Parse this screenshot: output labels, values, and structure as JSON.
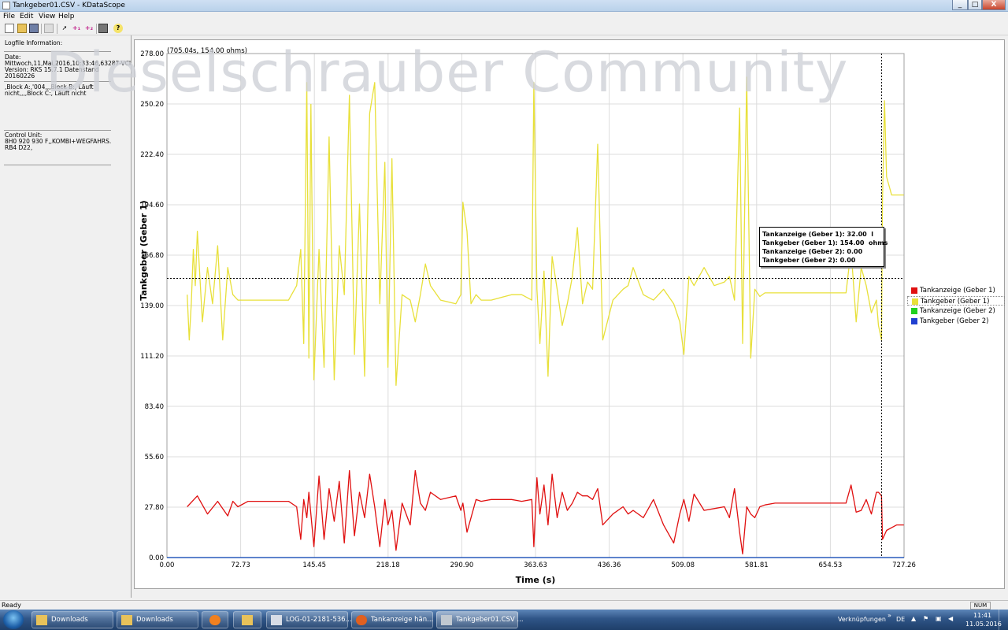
{
  "window": {
    "title": "Tankgeber01.CSV - KDataScope",
    "minimize": "_",
    "maximize": "□",
    "close": "X"
  },
  "menu": [
    "File",
    "Edit",
    "View",
    "Help"
  ],
  "left_panel": {
    "logfile_title": "Logfile Information:",
    "date_label": "Date:",
    "date_value": "Mittwoch,11,Mai,2016,10:33:46,63287-VCI",
    "version_value": "Version: RKS 15.7.1 Datenstand",
    "build_value": "20160226",
    "blocks_line1": ",Block A:,'004,,,Block B:, Läuft",
    "blocks_line2": "nicht,,,,Block C:, Läuft nicht",
    "control_unit_label": "Control Unit:",
    "control_unit_line1": "8H0 920 930 F,,KOMBI+WEGFAHRS.",
    "control_unit_line2": "RB4 D22,"
  },
  "chart_data": {
    "type": "line",
    "cursor_readout": "(705.04s, 154.00 ohms)",
    "ylabel": "Tankgeber (Geber 1)",
    "xlabel": "Time (s)",
    "ylim": [
      0,
      278
    ],
    "xlim": [
      0,
      727.26
    ],
    "y_ticks": [
      "0.00",
      "27.80",
      "55.60",
      "83.40",
      "111.20",
      "139.00",
      "166.80",
      "194.60",
      "222.40",
      "250.20",
      "278.00"
    ],
    "x_ticks": [
      "0.00",
      "72.73",
      "145.45",
      "218.18",
      "290.90",
      "363.63",
      "436.36",
      "509.08",
      "581.81",
      "654.53",
      "727.26"
    ],
    "cursor_x": 705.04,
    "cursor_y": 154.0,
    "grid": true,
    "legend_position": "right",
    "series": [
      {
        "name": "Tankanzeige (Geber 1)",
        "color": "#e01010",
        "x": [
          20,
          30,
          40,
          50,
          60,
          65,
          70,
          80,
          100,
          120,
          128,
          132,
          135,
          138,
          140,
          145,
          150,
          155,
          160,
          165,
          170,
          175,
          180,
          185,
          190,
          195,
          200,
          205,
          210,
          215,
          218,
          222,
          226,
          232,
          240,
          245,
          250,
          255,
          260,
          270,
          285,
          290,
          292,
          296,
          300,
          305,
          310,
          320,
          340,
          350,
          360,
          362,
          365,
          368,
          372,
          376,
          380,
          385,
          390,
          395,
          400,
          405,
          410,
          415,
          420,
          425,
          430,
          440,
          450,
          455,
          460,
          470,
          480,
          490,
          500,
          506,
          510,
          515,
          520,
          530,
          540,
          550,
          555,
          560,
          565,
          568,
          572,
          576,
          580,
          585,
          590,
          600,
          620,
          640,
          660,
          670,
          675,
          680,
          685,
          690,
          695,
          700,
          702,
          705,
          706,
          710,
          720,
          727
        ],
        "values": [
          28,
          34,
          24,
          31,
          23,
          31,
          28,
          31,
          31,
          31,
          28,
          10,
          32,
          22,
          36,
          6,
          45,
          10,
          38,
          20,
          42,
          8,
          48,
          12,
          36,
          22,
          46,
          28,
          6,
          32,
          18,
          26,
          4,
          30,
          18,
          48,
          30,
          26,
          36,
          32,
          34,
          26,
          30,
          14,
          22,
          32,
          31,
          32,
          32,
          31,
          32,
          6,
          44,
          24,
          40,
          18,
          46,
          22,
          36,
          26,
          30,
          36,
          34,
          34,
          32,
          38,
          18,
          24,
          28,
          24,
          26,
          22,
          32,
          18,
          8,
          24,
          32,
          20,
          35,
          26,
          27,
          28,
          22,
          38,
          14,
          2,
          28,
          24,
          22,
          28,
          29,
          30,
          30,
          30,
          30,
          30,
          40,
          25,
          26,
          32,
          24,
          36,
          36,
          34,
          10,
          15,
          18,
          18
        ]
      },
      {
        "name": "Tankgeber (Geber 1)",
        "color": "#e8e03a",
        "x": [
          20,
          22,
          24,
          26,
          28,
          30,
          35,
          40,
          45,
          50,
          55,
          60,
          65,
          70,
          80,
          100,
          120,
          128,
          132,
          135,
          138,
          140,
          142,
          145,
          150,
          155,
          160,
          165,
          170,
          175,
          180,
          185,
          190,
          195,
          200,
          205,
          210,
          215,
          218,
          222,
          226,
          232,
          240,
          245,
          250,
          255,
          260,
          270,
          285,
          290,
          292,
          296,
          300,
          305,
          310,
          320,
          340,
          350,
          360,
          362,
          365,
          368,
          372,
          376,
          380,
          385,
          390,
          395,
          400,
          405,
          410,
          415,
          420,
          425,
          430,
          440,
          450,
          455,
          460,
          470,
          480,
          490,
          500,
          506,
          510,
          515,
          520,
          530,
          540,
          550,
          555,
          560,
          565,
          568,
          572,
          576,
          580,
          585,
          590,
          600,
          620,
          640,
          660,
          670,
          675,
          680,
          685,
          690,
          695,
          700,
          702,
          705,
          706,
          708,
          710,
          715,
          720,
          727
        ],
        "values": [
          145,
          120,
          140,
          170,
          150,
          180,
          130,
          160,
          140,
          172,
          120,
          160,
          145,
          142,
          142,
          142,
          142,
          150,
          170,
          118,
          262,
          110,
          250,
          98,
          170,
          105,
          232,
          98,
          172,
          145,
          255,
          112,
          195,
          100,
          245,
          262,
          140,
          218,
          105,
          220,
          95,
          145,
          142,
          130,
          145,
          162,
          150,
          142,
          140,
          145,
          196,
          180,
          140,
          145,
          142,
          142,
          145,
          145,
          142,
          262,
          148,
          118,
          158,
          100,
          166,
          148,
          128,
          140,
          155,
          182,
          140,
          152,
          148,
          228,
          120,
          142,
          148,
          150,
          160,
          145,
          142,
          148,
          140,
          130,
          112,
          155,
          150,
          160,
          150,
          152,
          155,
          142,
          248,
          118,
          265,
          110,
          148,
          144,
          146,
          146,
          146,
          146,
          146,
          146,
          170,
          130,
          160,
          150,
          135,
          142,
          128,
          120,
          196,
          252,
          210,
          200,
          200,
          200
        ]
      },
      {
        "name": "Tankanzeige (Geber 2)",
        "color": "#20d020",
        "x": [
          0,
          727.26
        ],
        "values": [
          0,
          0
        ]
      },
      {
        "name": "Tankgeber (Geber 2)",
        "color": "#2040d0",
        "x": [
          0,
          727.26
        ],
        "values": [
          0,
          0
        ]
      }
    ]
  },
  "tooltip": {
    "lines": [
      "Tankanzeige (Geber 1): 32.00  l",
      "Tankgeber (Geber 1): 154.00  ohms",
      "Tankanzeige (Geber 2): 0.00",
      "Tankgeber (Geber 2): 0.00"
    ]
  },
  "watermark": "Dieselschrauber Community",
  "status": {
    "text": "Ready",
    "num": "NUM"
  },
  "taskbar": {
    "buttons": [
      {
        "label": "Downloads",
        "icon": "folder-icon",
        "color": "#e8c25a"
      },
      {
        "label": "Downloads",
        "icon": "folder-icon",
        "color": "#e8c25a"
      },
      {
        "label": "",
        "icon": "media-player-icon",
        "color": "#f08020"
      },
      {
        "label": "",
        "icon": "explorer-icon",
        "color": "#e8c25a"
      },
      {
        "label": "LOG-01-2181-536...",
        "icon": "document-icon",
        "color": "#d8dde6"
      },
      {
        "label": "Tankanzeige hän...",
        "icon": "firefox-icon",
        "color": "#e06020"
      },
      {
        "label": "Tankgeber01.CSV ...",
        "icon": "kdatascope-icon",
        "color": "#c0c8d0"
      }
    ],
    "tray_links": "Verknüpfungen",
    "tray_lang": "DE",
    "clock_time": "11:41",
    "clock_date": "11.05.2016"
  }
}
